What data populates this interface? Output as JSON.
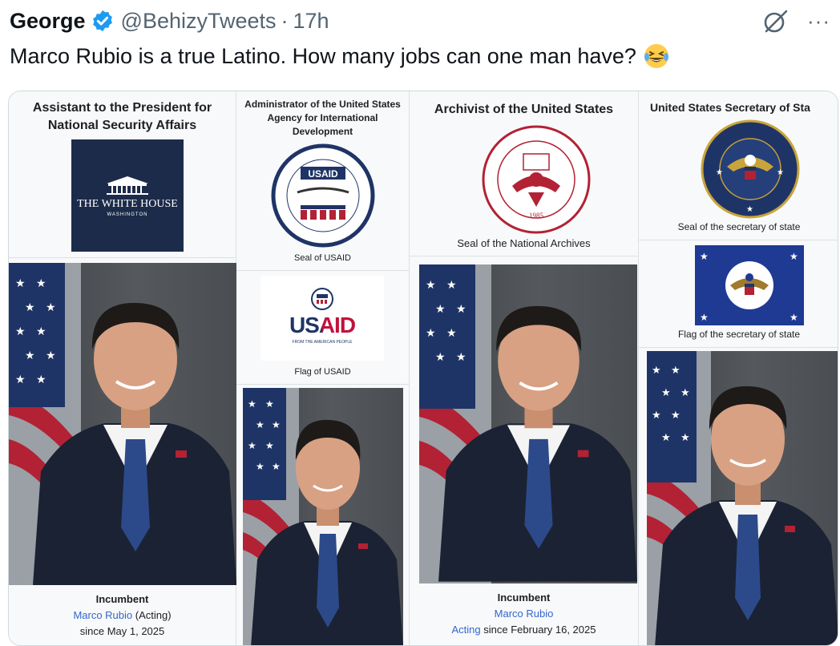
{
  "tweet": {
    "display_name": "George",
    "handle": "@BehizyTweets",
    "separator": "·",
    "time": "17h",
    "text": "Marco Rubio is a true Latino. How many jobs can one man have?",
    "more": "···"
  },
  "columns": {
    "nsa": {
      "title": "Assistant to the President for National Security Affairs",
      "logo_line1": "THE WHITE HOUSE",
      "logo_line2": "WASHINGTON",
      "incumbent_label": "Incumbent",
      "name": "Marco Rubio",
      "acting": "(Acting)",
      "since": "since May 1, 2025"
    },
    "usaid": {
      "title": "Administrator of the United States Agency for International Development",
      "seal_caption": "Seal of USAID",
      "flag_caption": "Flag of USAID",
      "usaid_word": "USAID",
      "usaid_tagline": "FROM THE AMERICAN PEOPLE"
    },
    "archivist": {
      "title": "Archivist of the United States",
      "seal_caption": "Seal of the National Archives",
      "seal_year": "1985",
      "incumbent_label": "Incumbent",
      "name": "Marco Rubio",
      "acting": "Acting",
      "since": "since February 16, 2025"
    },
    "state": {
      "title": "United States Secretary of Sta",
      "seal_caption": "Seal of the secretary of state",
      "flag_caption": "Flag of the secretary of state"
    }
  },
  "colors": {
    "link": "#3366cc",
    "verified": "#1d9bf0",
    "navy": "#1c2b4a"
  }
}
